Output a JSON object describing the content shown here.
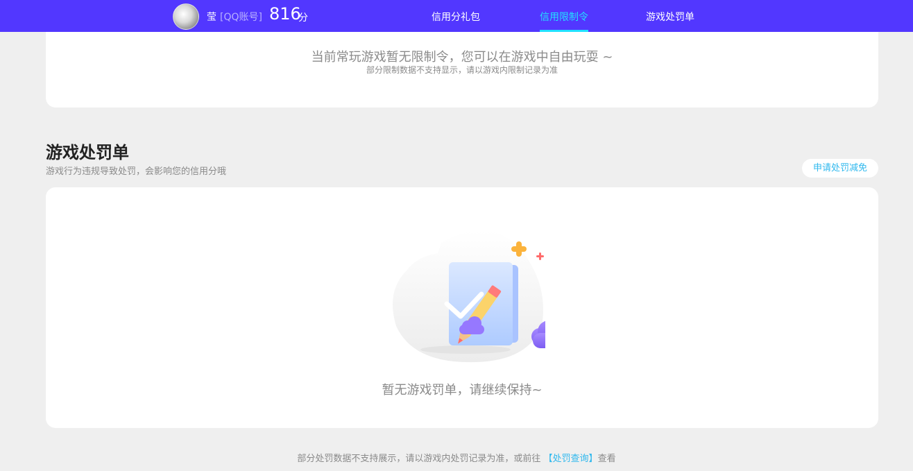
{
  "header": {
    "username": "莹",
    "account_type": "[QQ账号]",
    "score": "816",
    "score_unit": "分",
    "nav": [
      {
        "label": "信用分礼包",
        "active": false
      },
      {
        "label": "信用限制令",
        "active": true
      },
      {
        "label": "游戏处罚单",
        "active": false
      }
    ],
    "colors": {
      "bar": "#5237ff",
      "active": "#22e2ff"
    }
  },
  "restriction": {
    "message": "当前常玩游戏暂无限制令，您可以在游戏中自由玩耍 ~",
    "note": "部分限制数据不支持显示，请以游戏内限制记录为准"
  },
  "penalty": {
    "title": "游戏处罚单",
    "subtitle": "游戏行为违规导致处罚，会影响您的信用分哦",
    "appeal_button": "申请处罚减免",
    "empty_message": "暂无游戏罚单，请继续保持~"
  },
  "footer": {
    "text_before": "部分处罚数据不支持展示，请以游戏内处罚记录为准，或前往 ",
    "link": "【处罚查询】",
    "text_after": "查看"
  }
}
